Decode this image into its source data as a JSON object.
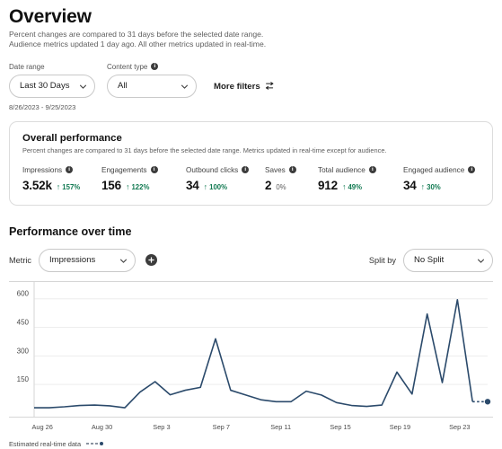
{
  "header": {
    "title": "Overview",
    "subtitle": "Percent changes are compared to 31 days before the selected date range. Audience metrics updated 1 day ago. All other metrics updated in real-time."
  },
  "filters": {
    "date_range": {
      "label": "Date range",
      "value": "Last 30 Days"
    },
    "content_type": {
      "label": "Content type",
      "value": "All",
      "info_icon": "info-icon"
    },
    "more_filters": {
      "label": "More filters",
      "icon": "filter-sliders-icon"
    },
    "date_range_note": "8/26/2023 - 9/25/2023"
  },
  "overall": {
    "title": "Overall performance",
    "subtitle": "Percent changes are compared to 31 days before the selected date range. Metrics updated in real-time except for audience.",
    "metrics": [
      {
        "label": "Impressions",
        "value": "3.52k",
        "delta": "157%",
        "direction": "up",
        "arrow": "↑"
      },
      {
        "label": "Engagements",
        "value": "156",
        "delta": "122%",
        "direction": "up",
        "arrow": "↑"
      },
      {
        "label": "Outbound clicks",
        "value": "34",
        "delta": "100%",
        "direction": "up",
        "arrow": "↑"
      },
      {
        "label": "Saves",
        "value": "2",
        "delta": "0%",
        "direction": "flat",
        "arrow": ""
      },
      {
        "label": "Total audience",
        "value": "912",
        "delta": "49%",
        "direction": "up",
        "arrow": "↑"
      },
      {
        "label": "Engaged audience",
        "value": "34",
        "delta": "30%",
        "direction": "up",
        "arrow": "↑"
      }
    ]
  },
  "performance": {
    "title": "Performance over time",
    "metric_label": "Metric",
    "metric_value": "Impressions",
    "add_metric_icon": "plus-circle-icon",
    "split_label": "Split by",
    "split_value": "No Split",
    "footnote": "Estimated real-time data"
  },
  "colors": {
    "line": "#2b4a6b",
    "positive": "#127a52",
    "neutral": "#5e5e5e",
    "border": "#dcdcdc",
    "grid": "#ededed"
  },
  "chart_data": {
    "type": "line",
    "title": "Performance over time",
    "xlabel": "",
    "ylabel": "Impressions",
    "ylim": [
      0,
      660
    ],
    "grid": true,
    "legend_position": "none",
    "yticks": [
      150,
      300,
      450,
      600
    ],
    "xticks": [
      "Aug 26",
      "Aug 30",
      "Sep 3",
      "Sep 7",
      "Sep 11",
      "Sep 15",
      "Sep 19",
      "Sep 23"
    ],
    "x": [
      "Aug 26",
      "Aug 27",
      "Aug 28",
      "Aug 29",
      "Aug 30",
      "Aug 31",
      "Sep 1",
      "Sep 2",
      "Sep 3",
      "Sep 4",
      "Sep 5",
      "Sep 6",
      "Sep 7",
      "Sep 8",
      "Sep 9",
      "Sep 10",
      "Sep 11",
      "Sep 12",
      "Sep 13",
      "Sep 14",
      "Sep 15",
      "Sep 16",
      "Sep 17",
      "Sep 18",
      "Sep 19",
      "Sep 20",
      "Sep 21",
      "Sep 22",
      "Sep 23",
      "Sep 24",
      "Sep 25"
    ],
    "series": [
      {
        "name": "Impressions",
        "values": [
          28,
          28,
          33,
          40,
          42,
          38,
          28,
          110,
          165,
          96,
          120,
          135,
          390,
          120,
          95,
          70,
          60,
          60,
          115,
          95,
          55,
          40,
          35,
          42,
          215,
          100,
          520,
          160,
          595,
          60,
          60
        ]
      }
    ],
    "estimated_tail": {
      "from_index": 29,
      "to_index": 30,
      "style": "dashed",
      "end_marker": "dot"
    }
  }
}
